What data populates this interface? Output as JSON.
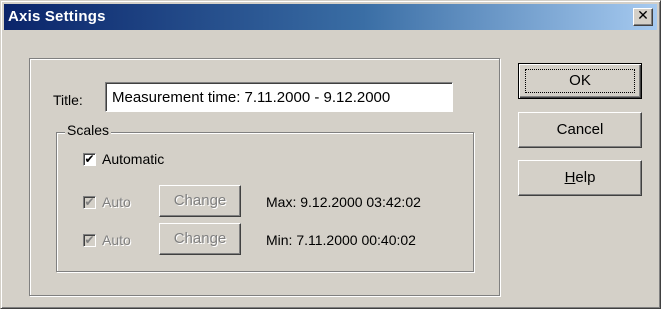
{
  "window": {
    "title": "Axis Settings",
    "close_glyph": "✕"
  },
  "form": {
    "title_label": "Title:",
    "title_value": "Measurement time: 7.11.2000 - 9.12.2000"
  },
  "scales": {
    "legend": "Scales",
    "automatic": {
      "label": "Automatic",
      "checked": true,
      "glyph": "✔"
    },
    "max_row": {
      "auto_label": "Auto",
      "auto_checked": true,
      "glyph": "✔",
      "change_label": "Change",
      "value": "Max: 9.12.2000 03:42:02"
    },
    "min_row": {
      "auto_label": "Auto",
      "auto_checked": true,
      "glyph": "✔",
      "change_label": "Change",
      "value": "Min: 7.11.2000 00:40:02"
    }
  },
  "buttons": {
    "ok": "OK",
    "cancel": "Cancel",
    "help_mnemonic": "H",
    "help_rest": "elp"
  },
  "colors": {
    "face": "#d4d0c8",
    "titlebar_start": "#0a246a",
    "titlebar_end": "#a6caf0",
    "disabled_text": "#808080"
  },
  "icons": {
    "close": "close-icon",
    "check": "checkmark-icon"
  }
}
